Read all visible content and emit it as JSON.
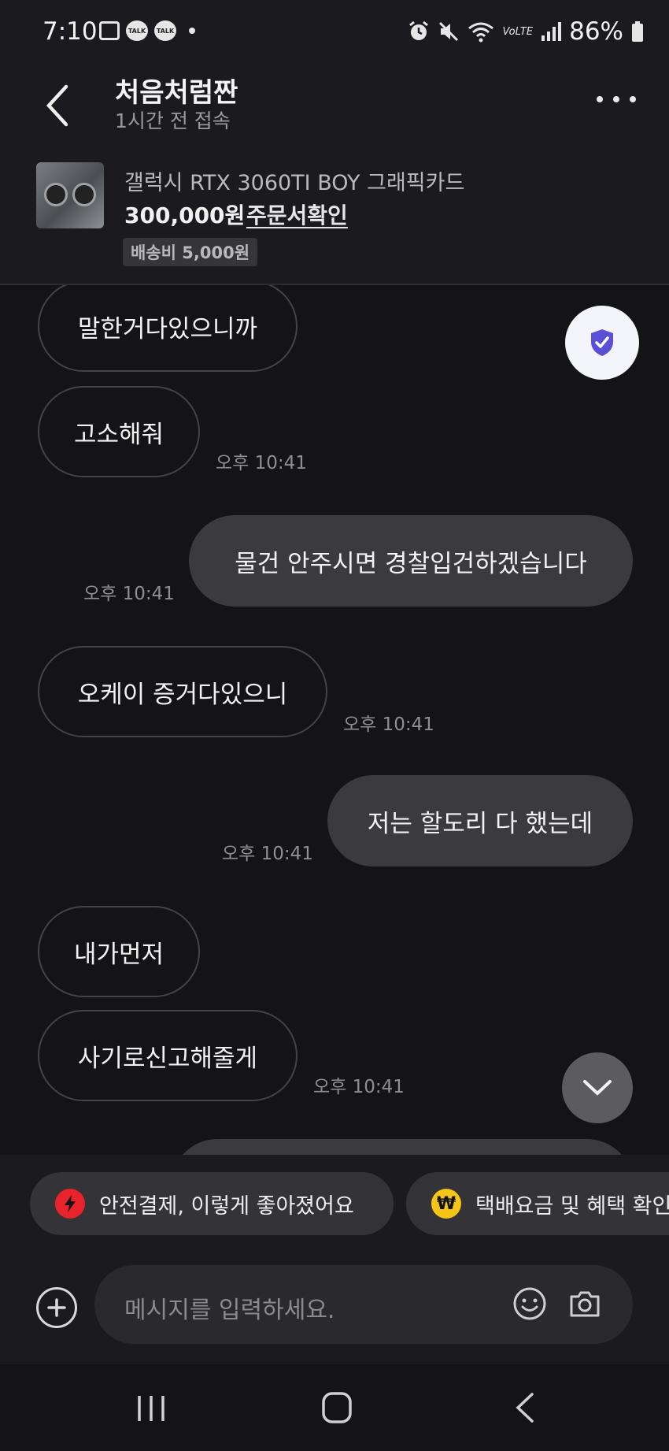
{
  "status_bar": {
    "time": "7:10",
    "talk_label": "TALK",
    "lte_label": "VoLTE",
    "battery": "86%"
  },
  "header": {
    "title": "처음처럼짠",
    "subtitle": "1시간 전 접속"
  },
  "product": {
    "name": "갤럭시 RTX 3060TI BOY 그래픽카드",
    "price": "300,000원",
    "order_link": "주문서확인",
    "shipping": "배송비 5,000원"
  },
  "messages": [
    {
      "dir": "in",
      "text": "말한거다있으니까",
      "time": ""
    },
    {
      "dir": "in",
      "text": "고소해줘",
      "time": "오후 10:41"
    },
    {
      "dir": "out",
      "text": "물건 안주시면 경찰입건하겠습니다",
      "time": "오후 10:41"
    },
    {
      "dir": "in",
      "text": "오케이 증거다있으니",
      "time": "오후 10:41"
    },
    {
      "dir": "out",
      "text": "저는 할도리 다 했는데",
      "time": "오후 10:41"
    },
    {
      "dir": "in",
      "text": "내가먼저",
      "time": ""
    },
    {
      "dir": "in",
      "text": "사기로신고해줄게",
      "time": "오후 10:41"
    }
  ],
  "chips": [
    {
      "label": "안전결제, 이렇게 좋아졌어요",
      "icon": "lightning-icon",
      "color": "#e8232a"
    },
    {
      "label": "택배요금 및 혜택 확인",
      "icon": "won-coin-icon",
      "color": "#f5c518"
    }
  ],
  "input": {
    "placeholder": "메시지를 입력하세요."
  },
  "colors": {
    "background": "#141417",
    "bar": "#1b1b1f",
    "outgoing_bubble": "#3a3a3f",
    "shield_accent": "#5b4fd6"
  }
}
